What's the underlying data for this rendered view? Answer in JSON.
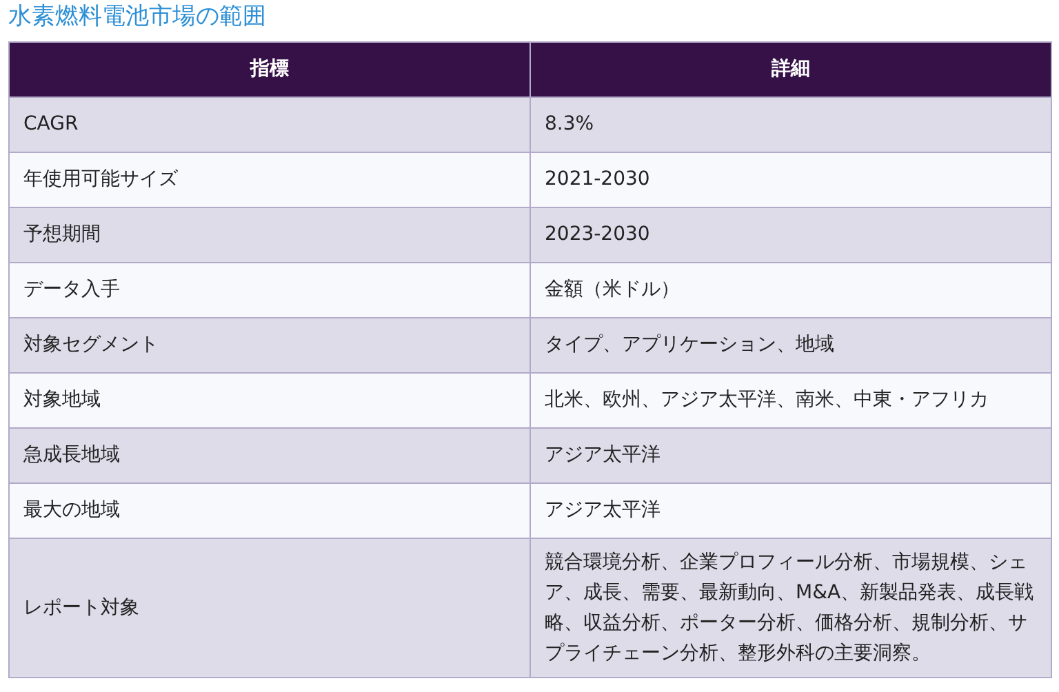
{
  "title": "水素燃料電池市場の範囲",
  "table": {
    "columns": [
      "指標",
      "詳細"
    ],
    "rows": [
      [
        "CAGR",
        "8.3%"
      ],
      [
        "年使用可能サイズ",
        "2021-2030"
      ],
      [
        "予想期間",
        "2023-2030"
      ],
      [
        "データ入手",
        "金額（米ドル）"
      ],
      [
        "対象セグメント",
        "タイプ、アプリケーション、地域"
      ],
      [
        "対象地域",
        "北米、欧州、アジア太平洋、南米、中東・アフリカ"
      ],
      [
        "急成長地域",
        "アジア太平洋"
      ],
      [
        "最大の地域",
        "アジア太平洋"
      ],
      [
        "レポート対象",
        "競合環境分析、企業プロフィール分析、市場規模、シェア、成長、需要、最新動向、M&A、新製品発表、成長戦略、収益分析、ポーター分析、価格分析、規制分析、サプライチェーン分析、整形外科の主要洞察。"
      ]
    ]
  }
}
